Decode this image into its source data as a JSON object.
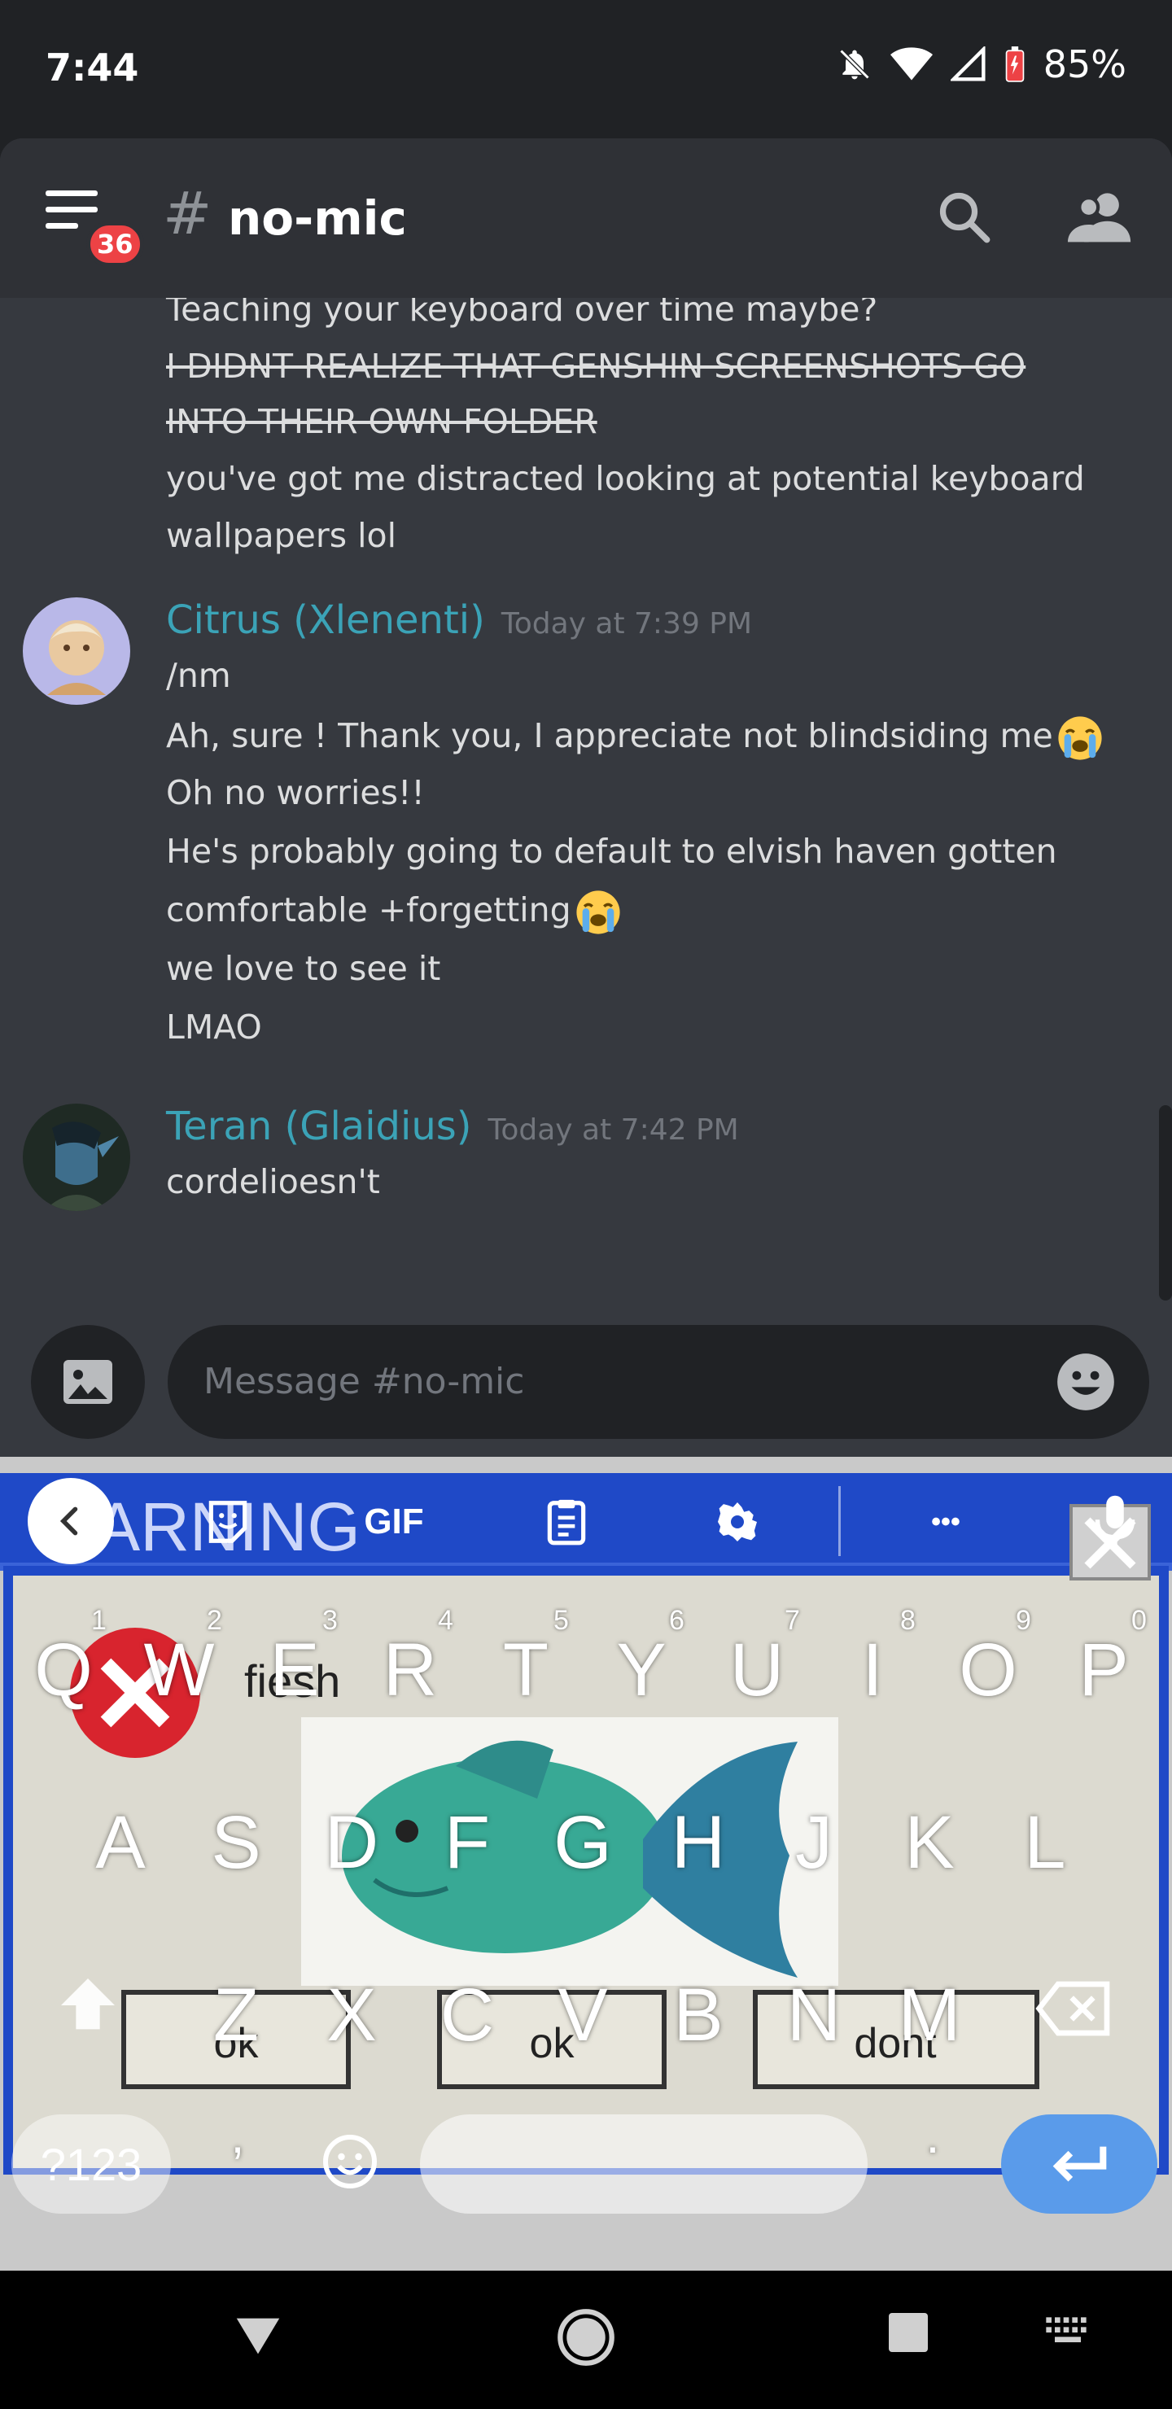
{
  "status_bar": {
    "time": "7:44",
    "battery": "85%",
    "icons": [
      "notifications-off-icon",
      "wifi-icon",
      "signal-icon",
      "battery-icon"
    ]
  },
  "header": {
    "unread_badge": "36",
    "channel_hash": "#",
    "channel_name": "no-mic",
    "icons": [
      "hamburger-menu-icon",
      "search-icon",
      "members-icon"
    ]
  },
  "messages": {
    "prev_lines": [
      "Teaching your keyboard over time maybe?",
      "I DIDNT REALIZE THAT GENSHIN SCREENSHOTS GO",
      "INTO THEIR OWN FOLDER",
      "you've got me distracted looking at potential keyboard",
      "wallpapers lol"
    ],
    "groups": [
      {
        "author": "Citrus (Xlenenti)",
        "timestamp": "Today at 7:39 PM",
        "lines": [
          "/nm",
          "Ah, sure ! Thank you, I appreciate not blindsiding me",
          "Oh no worries!!",
          "He's probably going to default to elvish haven gotten",
          "comfortable +forgetting",
          "we love to see it",
          "LMAO"
        ]
      },
      {
        "author": "Teran (Glaidius)",
        "timestamp": "Today at 7:42 PM",
        "lines": [
          "cordelioesn't"
        ]
      }
    ],
    "emoji_name": "loudly-crying-emoji"
  },
  "composer": {
    "placeholder": "Message #no-mic"
  },
  "keyboard": {
    "toolbar": {
      "gif_label": "GIF",
      "more_label": "•••"
    },
    "row1": [
      "Q",
      "W",
      "E",
      "R",
      "T",
      "Y",
      "U",
      "I",
      "O",
      "P"
    ],
    "row1_hints": [
      "1",
      "2",
      "3",
      "4",
      "5",
      "6",
      "7",
      "8",
      "9",
      "0"
    ],
    "row2": [
      "A",
      "S",
      "D",
      "F",
      "G",
      "H",
      "J",
      "K",
      "L"
    ],
    "row3": [
      "Z",
      "X",
      "C",
      "V",
      "B",
      "N",
      "M"
    ],
    "symbols_label": "?123",
    "comma_label": ",",
    "period_label": ".",
    "wallpaper": {
      "title": "WARNING",
      "subtitle": "fiesh",
      "buttons": [
        "ok",
        "ok",
        "dont"
      ]
    }
  },
  "colors": {
    "accent": "#3ba3b7",
    "background": "#36393f",
    "header": "#2f3136",
    "badge": "#ed4245",
    "enter_key": "#5a9bea"
  }
}
